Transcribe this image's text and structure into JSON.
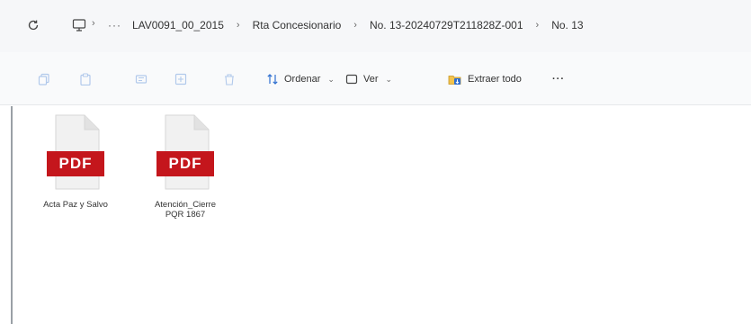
{
  "address_bar": {
    "breadcrumbs": [
      "LAV0091_00_2015",
      "Rta Concesionario",
      "No. 13-20240729T211828Z-001",
      "No. 13"
    ],
    "overflow_label": "···"
  },
  "command_bar": {
    "sort_label": "Ordenar",
    "view_label": "Ver",
    "extract_label": "Extraer todo",
    "more_label": "···"
  },
  "files": [
    {
      "name": "Acta Paz y Salvo",
      "badge": "PDF"
    },
    {
      "name": "Atención_Cierre PQR 1867",
      "badge": "PDF"
    }
  ],
  "colors": {
    "pdf_red": "#c4161c",
    "accent_blue": "#2f6fd0"
  }
}
